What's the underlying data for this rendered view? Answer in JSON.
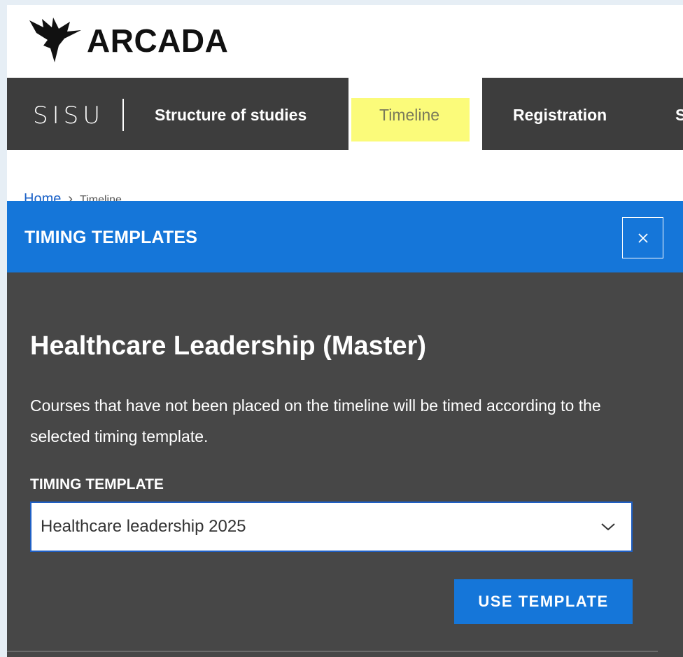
{
  "brand": {
    "name": "ARCADA"
  },
  "nav": {
    "product": "SISU",
    "items": [
      {
        "label": "Structure of studies"
      },
      {
        "label": "Timeline",
        "active": true
      },
      {
        "label": "Registration"
      },
      {
        "label": "S"
      }
    ],
    "active_highlight_color": "#fbfb7a"
  },
  "breadcrumb": {
    "home": "Home",
    "current": "Timeline"
  },
  "modal": {
    "title": "TIMING TEMPLATES",
    "program": "Healthcare Leadership (Master)",
    "description": "Courses that have not been placed on the timeline will be timed according to the selected timing template.",
    "field_label": "TIMING TEMPLATE",
    "selected_template": "Healthcare leadership 2025",
    "action_label": "USE TEMPLATE"
  },
  "colors": {
    "primary": "#1576d9",
    "nav_bg": "#3d3d3d",
    "modal_bg": "#474747"
  }
}
